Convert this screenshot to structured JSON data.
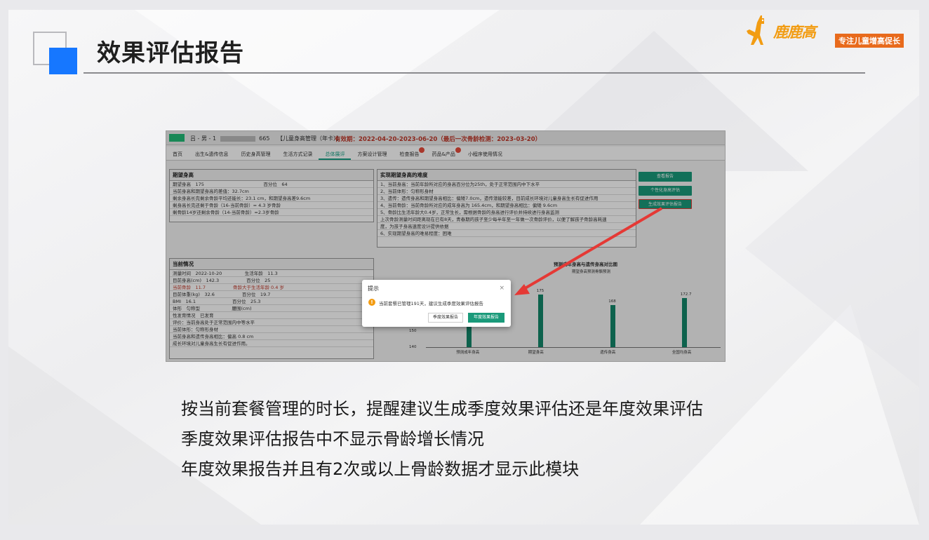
{
  "slide": {
    "title": "效果评估报告",
    "logo": {
      "name": "鹿鹿高",
      "tagline": "专注儿童增高促长"
    },
    "notes": [
      "按当前套餐管理的时长，提醒建议生成季度效果评估还是年度效果评估",
      "季度效果评估报告中不显示骨龄增长情况",
      "年度效果报告并且有2次或以上骨龄数据才显示此模块"
    ]
  },
  "screenshot": {
    "header": {
      "patient": "吕 - 男 - 1",
      "patient_suffix": "665",
      "plan": "【儿童身高管理（年卡）】",
      "validity": "有效期：2022-04-20-2023-06-20（最后一次骨龄检测：2023-03-20）"
    },
    "tabs": [
      {
        "label": "首页",
        "active": false
      },
      {
        "label": "出生&遗传信息",
        "active": false
      },
      {
        "label": "历史身高管理",
        "active": false
      },
      {
        "label": "生活方式记录",
        "active": false
      },
      {
        "label": "总体展评",
        "active": true
      },
      {
        "label": "方案设计管理",
        "active": false
      },
      {
        "label": "检查报告",
        "active": false,
        "badge": true
      },
      {
        "label": "药品&产品",
        "active": false,
        "badge": true
      },
      {
        "label": "小程序使用情况",
        "active": false
      }
    ],
    "expected_panel": {
      "title": "期望身高",
      "rows": [
        "期望身高　175　　　　　　　　　　　　　百分位　64",
        "当前身高和期望身高的差值：32.7cm",
        "剩余身高长完剩余骨龄平均还能长：23.1 cm，和期望身高差9.6cm",
        "剩身高长完还剩于骨龄（16-当前骨龄）= 4.3 岁骨龄",
        "剩骨龄14岁还剩余骨龄（14-当前骨龄）=2.3岁骨龄"
      ]
    },
    "difficulty_panel": {
      "title": "实现期望身高的难度",
      "rows": [
        "1、当前身高：当前年龄所对应的身高百分位为25th，处于正常范围内中下水平",
        "2、当前体形：匀称形身材",
        "3、遗传：遗传身高和期望身高相比：偏矮7.0cm，遗传潜能较差，目前成长环境对儿童身高生长有促进作用",
        "4、当前骨龄：当前骨龄所对应的成年身高为 165.4cm，和期望身高相比：偏矮 9.6cm",
        "5、骨龄比生活年龄大0.4岁，正常生长，需根据骨龄的身高进行评价并持续进行身高监测",
        "上次骨龄测量时间距离现在已有8天，青春期的孩子至少每半年至一年做一次骨龄评价，以便了解孩子骨龄高耗速",
        "度，为孩子身高速度设计提供依据",
        "6、实现期望身高的难易程度：困难"
      ]
    },
    "side_buttons": [
      "查看报告",
      "个性化身高评估",
      "生成效果评估报告"
    ],
    "current_panel": {
      "title": "当前情况",
      "rows": [
        {
          "text": "测量时间　2022-10-20　　　　　生活年龄　11.3",
          "warn": false
        },
        {
          "text": "目前身高(cm)　142.3　　　　　　百分位　25",
          "warn": false
        },
        {
          "text": "当前骨龄　11.7　　　　　　骨龄大于生活年龄 0.4 岁",
          "warn": true
        },
        {
          "text": "目前体重(kg)　32.6　　　　　　百分位　19.7",
          "warn": false
        },
        {
          "text": "BMI　16.1　　　　　　　　百分位　25.3",
          "warn": false
        },
        {
          "text": "体形　匀称型　　　　　　　腰围(cm)",
          "warn": false
        },
        {
          "text": "性发育情况　已发育",
          "warn": false
        },
        {
          "text": "评价：当前身高处于正常范围内中等水平",
          "warn": false
        },
        {
          "text": "当前体形：匀称形身材",
          "warn": false
        },
        {
          "text": "当前身高和遗传身高相比：偏高 0.8 cm",
          "warn": false
        },
        {
          "text": "成长环境对儿童身高生长有促进作用。",
          "warn": false
        }
      ]
    },
    "chart": {
      "title": "预测成年身高与遗传身高对比图",
      "legend": "期望身高预测骨骼预测",
      "ytick_mid": "150",
      "ytick_low": "140"
    },
    "dialog": {
      "title": "提示",
      "message": "当前套餐已管理191天，建议生成季度效果评估报告",
      "btn_quarter": "季度效果报告",
      "btn_annual": "年度效果报告"
    },
    "colors": {
      "accent": "#1677ff",
      "green": "#1a9a7a",
      "arrow": "#e53935",
      "logo": "#f29c12"
    }
  },
  "chart_data": {
    "type": "bar",
    "categories": [
      "预测成年身高",
      "期望身高",
      "遗传身高",
      "全国均身高"
    ],
    "values": [
      166,
      175,
      168,
      172.7
    ],
    "ylim": [
      140,
      180
    ],
    "data_labels": [
      "",
      "175",
      "168",
      "172.7"
    ]
  }
}
